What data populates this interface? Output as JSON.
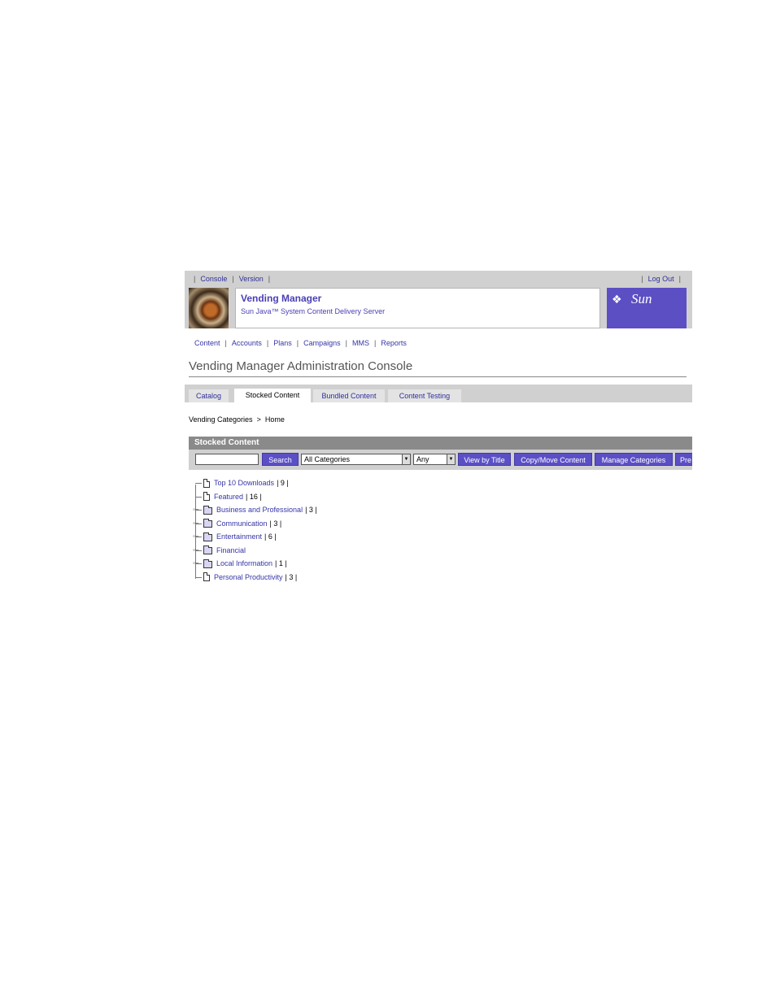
{
  "util": {
    "console": "Console",
    "version": "Version",
    "logout": "Log Out"
  },
  "banner": {
    "title": "Vending Manager",
    "subtitle": "Sun Java™ System Content Delivery Server",
    "logo": "Sun"
  },
  "nav": {
    "items": [
      "Content",
      "Accounts",
      "Plans",
      "Campaigns",
      "MMS",
      "Reports"
    ]
  },
  "page_title": "Vending Manager Administration Console",
  "tabs": [
    "Catalog",
    "Stocked Content",
    "Bundled Content",
    "Content Testing"
  ],
  "active_tab": "Stocked Content",
  "breadcrumb": {
    "parent": "Vending Categories",
    "separator": ">",
    "current": "Home"
  },
  "panel": {
    "title": "Stocked Content",
    "search_value": "",
    "search_button": "Search",
    "category_select": "All Categories",
    "type_select": "Any",
    "buttons": [
      "View by Title",
      "Copy/Move Content",
      "Manage Categories",
      "Pre"
    ]
  },
  "tree": [
    {
      "label": "Top 10 Downloads",
      "count": "| 9 |",
      "type": "doc"
    },
    {
      "label": "Featured",
      "count": "| 16 |",
      "type": "doc"
    },
    {
      "label": "Business and Professional",
      "count": "| 3 |",
      "type": "folder"
    },
    {
      "label": "Communication",
      "count": "| 3 |",
      "type": "folder"
    },
    {
      "label": "Entertainment",
      "count": "| 6 |",
      "type": "folder"
    },
    {
      "label": "Financial",
      "count": "",
      "type": "folder"
    },
    {
      "label": "Local Information",
      "count": "| 1 |",
      "type": "folder"
    },
    {
      "label": "Personal Productivity",
      "count": "| 3 |",
      "type": "doc"
    }
  ],
  "colors": {
    "accent": "#5b4fc5",
    "link": "#3535a8",
    "bar": "#d0d0d0"
  }
}
